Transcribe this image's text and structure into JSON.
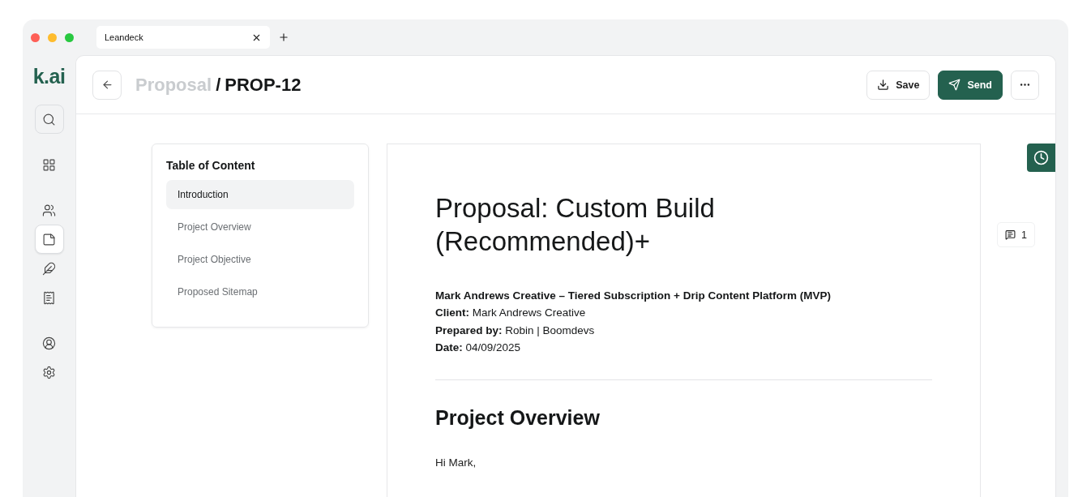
{
  "browser": {
    "tab": {
      "title": "Leandeck"
    }
  },
  "sidebar": {
    "logo": "k.ai",
    "items": [
      {
        "selected": false
      },
      {
        "selected": false
      },
      {
        "selected": false
      },
      {
        "selected": true
      },
      {
        "selected": false
      },
      {
        "selected": false
      },
      {
        "selected": false
      },
      {
        "selected": false
      }
    ]
  },
  "header": {
    "breadcrumb": {
      "parent": "Proposal",
      "separator": "/",
      "current": "PROP-12"
    },
    "buttons": [
      {
        "kind": "outline",
        "label": "Save"
      },
      {
        "kind": "primary",
        "label": "Send"
      },
      {
        "kind": "more"
      }
    ]
  },
  "toc": {
    "title": "Table of Content",
    "items": [
      {
        "label": "Introduction",
        "selected": true
      },
      {
        "label": "Project Overview",
        "selected": false
      },
      {
        "label": "Project Objective",
        "selected": false
      },
      {
        "label": "Proposed Sitemap",
        "selected": false
      }
    ]
  },
  "document": {
    "title": "Proposal: Custom Build (Recommended)+",
    "subtitle": "Mark Andrews Creative – Tiered Subscription + Drip Content Platform (MVP)",
    "meta": [
      "**Client:** Mark Andrews Creative",
      "**Prepared by:** Robin | Boomdevs",
      "**Date:** 04/09/2025"
    ],
    "section_title": "Project Overview",
    "greeting": "Hi Mark,"
  },
  "comments": {
    "count": "1"
  }
}
